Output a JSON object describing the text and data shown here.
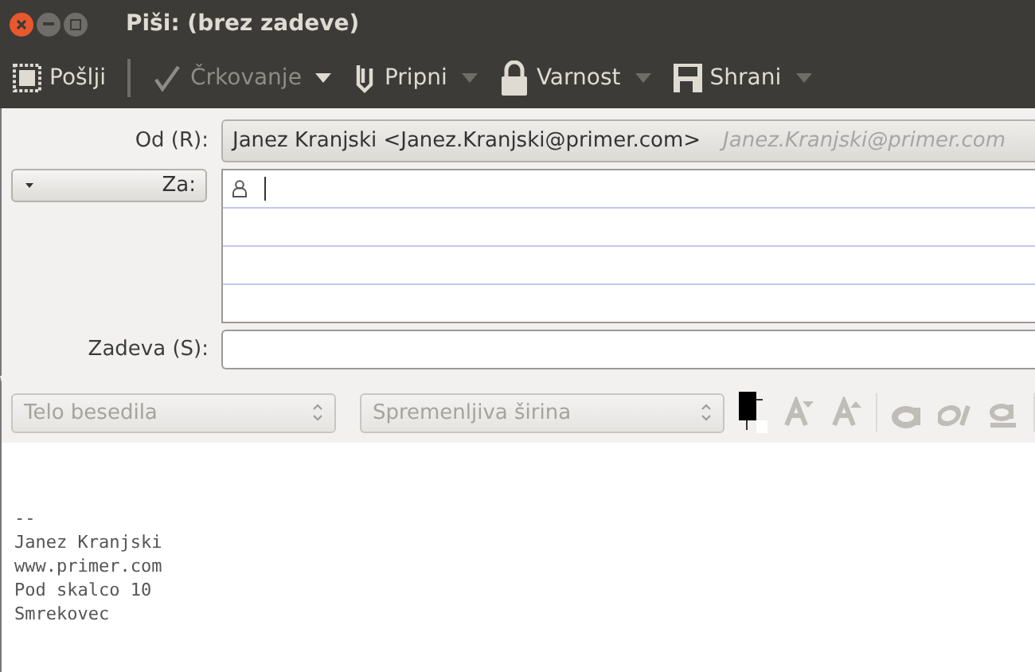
{
  "window": {
    "title": "Piši: (brez zadeve)"
  },
  "toolbar": [
    {
      "kind": "send",
      "label": "Pošlji",
      "disabled": false,
      "dropdown": false
    },
    {
      "kind": "spell",
      "label": "Črkovanje",
      "disabled": true,
      "dropdown": true
    },
    {
      "kind": "attach",
      "label": "Pripni",
      "disabled": false,
      "dropdown": true
    },
    {
      "kind": "security",
      "label": "Varnost",
      "disabled": false,
      "dropdown": true
    },
    {
      "kind": "save",
      "label": "Shrani",
      "disabled": false,
      "dropdown": true
    }
  ],
  "from": {
    "label": "Od (R):",
    "value": "Janez Kranjski <Janez.Kranjski@primer.com>",
    "hint": "Janez.Kranjski@primer.com"
  },
  "recipients": {
    "type_button": "Za:"
  },
  "subject": {
    "label": "Zadeva (S):"
  },
  "format_bar": {
    "paragraph": "Telo besedila",
    "font": "Spremenljiva širina",
    "disabled": true
  },
  "body": [
    "--",
    "Janez Kranjski",
    "www.primer.com",
    "Pod skalco 10",
    "Smrekovec"
  ]
}
